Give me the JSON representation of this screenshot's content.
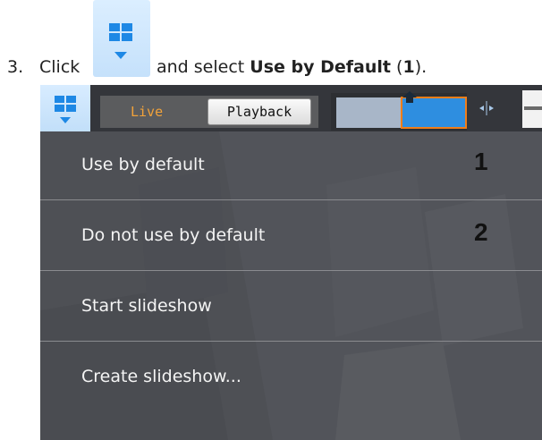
{
  "instruction": {
    "step_number": "3.",
    "click_text": "Click",
    "text_before": "and select",
    "bold_option": "Use by Default",
    "paren_open": " (",
    "callout_ref": "1",
    "paren_close": ")."
  },
  "toolbar": {
    "layouts_icon": "layout-grid-icon",
    "live_label": "Live",
    "playback_label": "Playback"
  },
  "menu": {
    "items": [
      {
        "label": "Use by default",
        "callout": "1"
      },
      {
        "label": "Do not use by default",
        "callout": "2"
      },
      {
        "label": "Start slideshow",
        "callout": ""
      },
      {
        "label": "Create slideshow...",
        "callout": ""
      }
    ]
  },
  "colors": {
    "accent_blue": "#2e8ee0",
    "accent_orange": "#f07e1a",
    "live_text": "#f1a23a",
    "menu_bg": "#46484e",
    "layout_button_bg": "#c9e3fb"
  }
}
